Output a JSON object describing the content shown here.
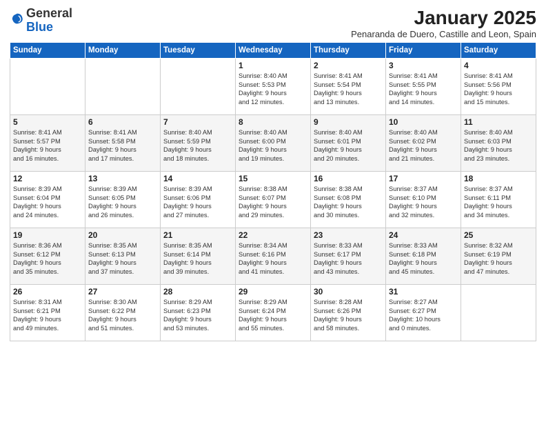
{
  "logo": {
    "general": "General",
    "blue": "Blue"
  },
  "title": "January 2025",
  "location": "Penaranda de Duero, Castille and Leon, Spain",
  "days_of_week": [
    "Sunday",
    "Monday",
    "Tuesday",
    "Wednesday",
    "Thursday",
    "Friday",
    "Saturday"
  ],
  "weeks": [
    [
      {
        "day": "",
        "content": ""
      },
      {
        "day": "",
        "content": ""
      },
      {
        "day": "",
        "content": ""
      },
      {
        "day": "1",
        "content": "Sunrise: 8:40 AM\nSunset: 5:53 PM\nDaylight: 9 hours\nand 12 minutes."
      },
      {
        "day": "2",
        "content": "Sunrise: 8:41 AM\nSunset: 5:54 PM\nDaylight: 9 hours\nand 13 minutes."
      },
      {
        "day": "3",
        "content": "Sunrise: 8:41 AM\nSunset: 5:55 PM\nDaylight: 9 hours\nand 14 minutes."
      },
      {
        "day": "4",
        "content": "Sunrise: 8:41 AM\nSunset: 5:56 PM\nDaylight: 9 hours\nand 15 minutes."
      }
    ],
    [
      {
        "day": "5",
        "content": "Sunrise: 8:41 AM\nSunset: 5:57 PM\nDaylight: 9 hours\nand 16 minutes."
      },
      {
        "day": "6",
        "content": "Sunrise: 8:41 AM\nSunset: 5:58 PM\nDaylight: 9 hours\nand 17 minutes."
      },
      {
        "day": "7",
        "content": "Sunrise: 8:40 AM\nSunset: 5:59 PM\nDaylight: 9 hours\nand 18 minutes."
      },
      {
        "day": "8",
        "content": "Sunrise: 8:40 AM\nSunset: 6:00 PM\nDaylight: 9 hours\nand 19 minutes."
      },
      {
        "day": "9",
        "content": "Sunrise: 8:40 AM\nSunset: 6:01 PM\nDaylight: 9 hours\nand 20 minutes."
      },
      {
        "day": "10",
        "content": "Sunrise: 8:40 AM\nSunset: 6:02 PM\nDaylight: 9 hours\nand 21 minutes."
      },
      {
        "day": "11",
        "content": "Sunrise: 8:40 AM\nSunset: 6:03 PM\nDaylight: 9 hours\nand 23 minutes."
      }
    ],
    [
      {
        "day": "12",
        "content": "Sunrise: 8:39 AM\nSunset: 6:04 PM\nDaylight: 9 hours\nand 24 minutes."
      },
      {
        "day": "13",
        "content": "Sunrise: 8:39 AM\nSunset: 6:05 PM\nDaylight: 9 hours\nand 26 minutes."
      },
      {
        "day": "14",
        "content": "Sunrise: 8:39 AM\nSunset: 6:06 PM\nDaylight: 9 hours\nand 27 minutes."
      },
      {
        "day": "15",
        "content": "Sunrise: 8:38 AM\nSunset: 6:07 PM\nDaylight: 9 hours\nand 29 minutes."
      },
      {
        "day": "16",
        "content": "Sunrise: 8:38 AM\nSunset: 6:08 PM\nDaylight: 9 hours\nand 30 minutes."
      },
      {
        "day": "17",
        "content": "Sunrise: 8:37 AM\nSunset: 6:10 PM\nDaylight: 9 hours\nand 32 minutes."
      },
      {
        "day": "18",
        "content": "Sunrise: 8:37 AM\nSunset: 6:11 PM\nDaylight: 9 hours\nand 34 minutes."
      }
    ],
    [
      {
        "day": "19",
        "content": "Sunrise: 8:36 AM\nSunset: 6:12 PM\nDaylight: 9 hours\nand 35 minutes."
      },
      {
        "day": "20",
        "content": "Sunrise: 8:35 AM\nSunset: 6:13 PM\nDaylight: 9 hours\nand 37 minutes."
      },
      {
        "day": "21",
        "content": "Sunrise: 8:35 AM\nSunset: 6:14 PM\nDaylight: 9 hours\nand 39 minutes."
      },
      {
        "day": "22",
        "content": "Sunrise: 8:34 AM\nSunset: 6:16 PM\nDaylight: 9 hours\nand 41 minutes."
      },
      {
        "day": "23",
        "content": "Sunrise: 8:33 AM\nSunset: 6:17 PM\nDaylight: 9 hours\nand 43 minutes."
      },
      {
        "day": "24",
        "content": "Sunrise: 8:33 AM\nSunset: 6:18 PM\nDaylight: 9 hours\nand 45 minutes."
      },
      {
        "day": "25",
        "content": "Sunrise: 8:32 AM\nSunset: 6:19 PM\nDaylight: 9 hours\nand 47 minutes."
      }
    ],
    [
      {
        "day": "26",
        "content": "Sunrise: 8:31 AM\nSunset: 6:21 PM\nDaylight: 9 hours\nand 49 minutes."
      },
      {
        "day": "27",
        "content": "Sunrise: 8:30 AM\nSunset: 6:22 PM\nDaylight: 9 hours\nand 51 minutes."
      },
      {
        "day": "28",
        "content": "Sunrise: 8:29 AM\nSunset: 6:23 PM\nDaylight: 9 hours\nand 53 minutes."
      },
      {
        "day": "29",
        "content": "Sunrise: 8:29 AM\nSunset: 6:24 PM\nDaylight: 9 hours\nand 55 minutes."
      },
      {
        "day": "30",
        "content": "Sunrise: 8:28 AM\nSunset: 6:26 PM\nDaylight: 9 hours\nand 58 minutes."
      },
      {
        "day": "31",
        "content": "Sunrise: 8:27 AM\nSunset: 6:27 PM\nDaylight: 10 hours\nand 0 minutes."
      },
      {
        "day": "",
        "content": ""
      }
    ]
  ]
}
